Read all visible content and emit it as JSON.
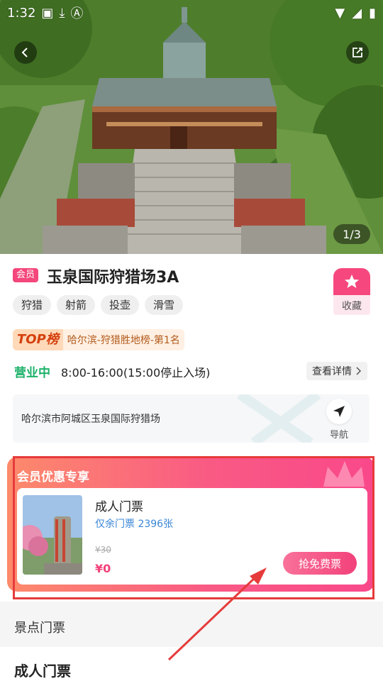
{
  "status_bar": {
    "time": "1:32"
  },
  "gallery": {
    "page_indicator": "1/3"
  },
  "header": {
    "vip_label": "会员",
    "title": "玉泉国际狩猎场3A",
    "favorite_label": "收藏"
  },
  "tags": [
    "狩猎",
    "射箭",
    "投壶",
    "滑雪"
  ],
  "ranking": {
    "logo": "TOP榜",
    "text": "哈尔滨-狩猎胜地榜-第1名"
  },
  "business": {
    "status": "营业中",
    "hours": "8:00-16:00(15:00停止入场)",
    "details_button": "查看详情"
  },
  "location": {
    "address": "哈尔滨市阿城区玉泉国际狩猎场",
    "nav_label": "导航"
  },
  "promo": {
    "title": "会员优惠专享",
    "ticket": {
      "name": "成人门票",
      "remaining": "仅余门票 2396张",
      "original_price": "¥30",
      "price": "¥0",
      "button": "抢免费票"
    }
  },
  "sections": {
    "scenic_tickets": "景点门票",
    "adult_tickets": "成人门票"
  },
  "colors": {
    "accent": "#f6487e",
    "open": "#1db16a",
    "link": "#3a86d8",
    "annotation": "#e63b3b"
  }
}
